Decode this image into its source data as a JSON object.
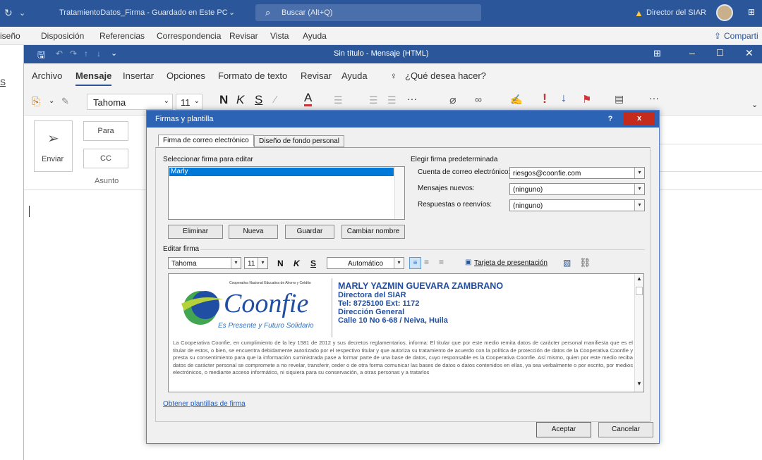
{
  "word": {
    "doc_title": "TratamientoDatos_Firma - Guardado en Este PC",
    "search_placeholder": "Buscar (Alt+Q)",
    "user": "Director del SIAR",
    "tabs": [
      "iseño",
      "Disposición",
      "Referencias",
      "Correspondencia",
      "Revisar",
      "Vista",
      "Ayuda"
    ],
    "share": "Comparti"
  },
  "outlook": {
    "title": "Sin título - Mensaje (HTML)",
    "menu": [
      "Archivo",
      "Mensaje",
      "Insertar",
      "Opciones",
      "Formato de texto",
      "Revisar",
      "Ayuda",
      "¿Qué desea hacer?"
    ],
    "font": "Tahoma",
    "size": "11",
    "bold": "N",
    "italic": "K",
    "underline": "S",
    "more": "···",
    "send": "Enviar",
    "to": "Para",
    "cc": "CC",
    "subject": "Asunto"
  },
  "dialog": {
    "title": "Firmas y plantilla",
    "help": "?",
    "close": "x",
    "tab_signature": "Firma de correo electrónico",
    "tab_stationery": "Diseño de fondo personal",
    "select_label": "Seleccionar firma para editar",
    "signatures": [
      "Marly"
    ],
    "delete": "Eliminar",
    "new": "Nueva",
    "save": "Guardar",
    "rename": "Cambiar nombre",
    "default_label": "Elegir firma predeterminada",
    "account_label": "Cuenta de correo electrónico:",
    "account_value": "riesgos@coonfie.com",
    "new_msgs_label": "Mensajes nuevos:",
    "new_msgs_value": "(ninguno)",
    "replies_label": "Respuestas o reenvíos:",
    "replies_value": "(ninguno)",
    "edit_label": "Editar firma",
    "edit_font": "Tahoma",
    "edit_size": "11",
    "edit_bold": "N",
    "edit_italic": "K",
    "edit_underline": "S",
    "edit_color": "Automático",
    "business_card": "Tarjeta de presentación",
    "get_templates": "Obtener plantillas de firma",
    "ok": "Aceptar",
    "cancel": "Cancelar"
  },
  "signature": {
    "coop_tagline": "Cooperativa Nacional Educativa de Ahorro y Crédito",
    "logo": "Coonfie",
    "slogan": "Es Presente y Futuro Solidario",
    "name": "MARLY YAZMIN GUEVARA ZAMBRANO",
    "role": "Directora del SIAR",
    "tel": "Tel: 8725100 Ext: 1172",
    "dept": "Dirección General",
    "address": "Calle 10 No 6-68 / Neiva, Huila",
    "legal": "La Cooperativa Coonfie, en cumplimiento de la ley 1581 de 2012 y sus decretos reglamentarios, informa: El titular que por este medio remita datos de carácter personal manifiesta que es el titular de estos, o bien, se encuentra debidamente autorizado por el respectivo titular y que autoriza su tratamiento de acuerdo con la política de protección de datos de la Cooperativa Coonfie y presta su consentimiento para que la información suministrada pase a formar parte de una base de datos, cuyo responsable es la Cooperativa Coonfie. Así mismo, quien por este medio reciba datos de carácter personal se compromete a no revelar, transferir, ceder o de otra forma comunicar las bases de datos o datos contenidos en ellas, ya sea verbalmente o por escrito, por medios electrónicos, o mediante acceso informático, ni siquiera para su conservación, a otras personas y a tratarlos"
  },
  "colors": {
    "word_blue": "#2b579a",
    "dialog_blue": "#2d63b4",
    "sig_blue": "#1f4ea3",
    "logo_green": "#2e9b3f",
    "flag_red": "#d13438"
  }
}
